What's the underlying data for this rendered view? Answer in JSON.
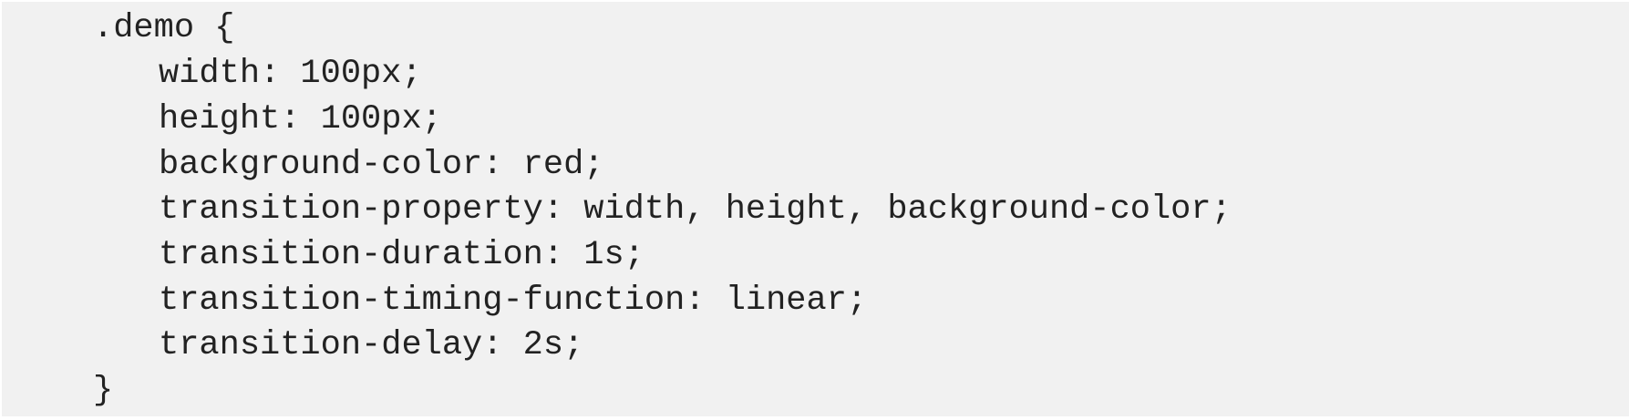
{
  "code": {
    "lines": [
      ".demo {",
      "width: 100px;",
      "height: 100px;",
      "background-color: red;",
      "transition-property: width, height, background-color;",
      "transition-duration: 1s;",
      "transition-timing-function: linear;",
      "transition-delay: 2s;",
      "}"
    ]
  }
}
